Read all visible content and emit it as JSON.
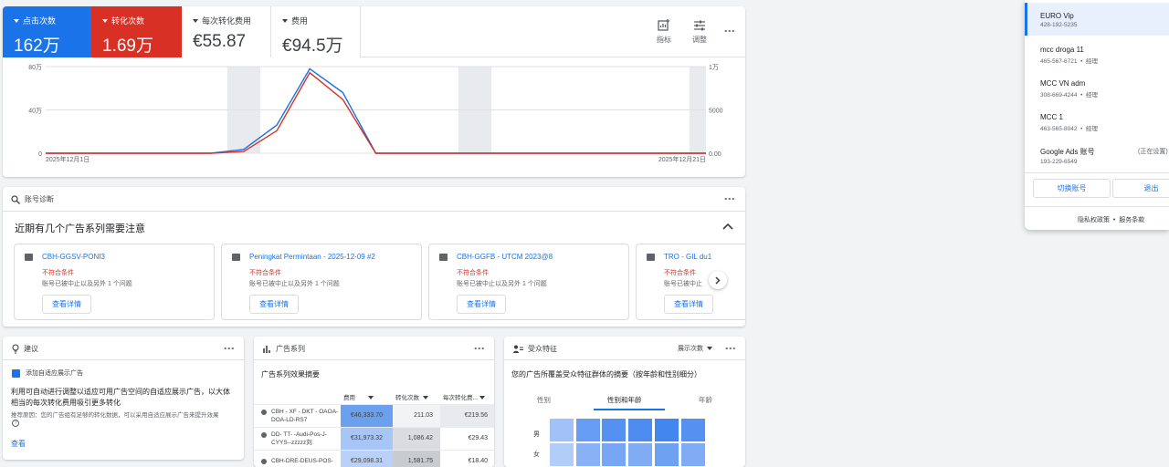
{
  "metrics": [
    {
      "label": "点击次数",
      "value": "162万"
    },
    {
      "label": "转化次数",
      "value": "1.69万"
    },
    {
      "label": "每次转化费用",
      "value": "€55.87"
    },
    {
      "label": "费用",
      "value": "€94.5万"
    }
  ],
  "toolbar": {
    "metrics_label": "指标",
    "adjust_label": "调整"
  },
  "chart_data": {
    "type": "line",
    "x": [
      "2025年12月1日",
      "2025年12月2日",
      "2025年12月3日",
      "2025年12月4日",
      "2025年12月5日",
      "2025年12月6日",
      "2025年12月7日",
      "2025年12月8日",
      "2025年12月9日",
      "2025年12月10日",
      "2025年12月11日",
      "2025年12月12日",
      "2025年12月13日",
      "2025年12月14日",
      "2025年12月15日",
      "2025年12月16日",
      "2025年12月17日",
      "2025年12月18日",
      "2025年12月19日",
      "2025年12月20日",
      "2025年12月21日"
    ],
    "x_tick_labels": [
      "2025年12月1日",
      "2025年12月21日"
    ],
    "left_axis_ticks": [
      "80万",
      "40万",
      "0"
    ],
    "right_axis_ticks": [
      "1万",
      "5000",
      "0.00"
    ],
    "ylim_left": [
      0,
      800000
    ],
    "ylim_right": [
      0,
      10000
    ],
    "series": [
      {
        "axis": "left",
        "color": "#1a73e8",
        "values": [
          0,
          0,
          0,
          0,
          0,
          0,
          35000,
          260000,
          780000,
          560000,
          0,
          0,
          0,
          0,
          0,
          0,
          0,
          0,
          0,
          0,
          0
        ]
      },
      {
        "axis": "right",
        "color": "#d93025",
        "values": [
          0,
          0,
          0,
          0,
          0,
          0,
          200,
          2600,
          9300,
          6200,
          0,
          0,
          0,
          0,
          0,
          0,
          0,
          0,
          0,
          0,
          0
        ]
      }
    ],
    "shaded_days": [
      6,
      13,
      20
    ],
    "grid": true
  },
  "diagnosis": {
    "label": "账号诊断",
    "title": "近期有几个广告系列需要注意",
    "cards": [
      {
        "name": "CBH-GGSV-PONI3",
        "status": "不符合条件",
        "detail": "账号已被中止以及另外 1 个问题",
        "button": "查看详情"
      },
      {
        "name": "Peningkat Permintaan - 2025-12-09 #2",
        "status": "不符合条件",
        "detail": "账号已被中止以及另外 1 个问题",
        "button": "查看详情"
      },
      {
        "name": "CBH-GGFB - UTCM 2023@8",
        "status": "不符合条件",
        "detail": "账号已被中止以及另外 1 个问题",
        "button": "查看详情"
      },
      {
        "name": "TRO - GIL du1",
        "status": "不符合条件",
        "detail": "账号已被中止",
        "button": "查看详情"
      }
    ]
  },
  "recommendation": {
    "label": "建议",
    "item_title": "添加自适应展示广告",
    "body": "利用可自动进行调整以适应可用广告空间的自适应展示广告，以大体相当的每次转化费用吸引更多转化",
    "reason": "推荐原因：您的广告组有足够的转化数据，可以采用自适应展示广告来提升效果",
    "link": "查看"
  },
  "campaigns": {
    "label": "广告系列",
    "subtitle": "广告系列效果摘要",
    "columns": [
      "费用",
      "转化次数",
      "每次转化费..."
    ],
    "rows": [
      {
        "name": "CBH - XF - DKT - OAOA-DOA-LD-RS7",
        "cost": "€46,333.70",
        "conv": "211.03",
        "cpa": "€219.56"
      },
      {
        "name": "DD- TT- -Audi-Pos-J-CYYS--zzzzz刘",
        "cost": "€31,973.32",
        "conv": "1,086.42",
        "cpa": "€29.43"
      },
      {
        "name": "CBH-DRE-DEUS-POS-",
        "cost": "€29,098.31",
        "conv": "1,581.75",
        "cpa": "€18.40"
      }
    ]
  },
  "audience": {
    "label": "受众特征",
    "selector": "展示次数",
    "subtitle": "您的广告所覆盖受众特征群体的摘要（按年龄和性别细分）",
    "tabs": [
      "性别",
      "性别和年龄",
      "年龄"
    ],
    "row_labels": [
      "男",
      "女"
    ],
    "heatmap": [
      [
        0.3,
        0.65,
        0.75,
        0.8,
        0.85,
        0.75
      ],
      [
        0.2,
        0.45,
        0.55,
        0.5,
        0.6,
        0.5
      ]
    ]
  },
  "accounts": {
    "list": [
      {
        "name": "EURO Vip",
        "id": "428-192-5235",
        "role": ""
      },
      {
        "name": "mcc droga 11",
        "id": "465-567-6721",
        "role": "经理"
      },
      {
        "name": "MCC VN adm",
        "id": "308-669-4244",
        "role": "经理"
      },
      {
        "name": "MCC 1",
        "id": "463-565-8042",
        "role": "经理"
      },
      {
        "name": "Google Ads 账号",
        "id": "193-229-6549",
        "role": "",
        "status": "(正在设置)"
      }
    ],
    "switch_label": "切换账号",
    "logout_label": "退出",
    "privacy": "隐私权政策",
    "terms": "服务条款"
  }
}
